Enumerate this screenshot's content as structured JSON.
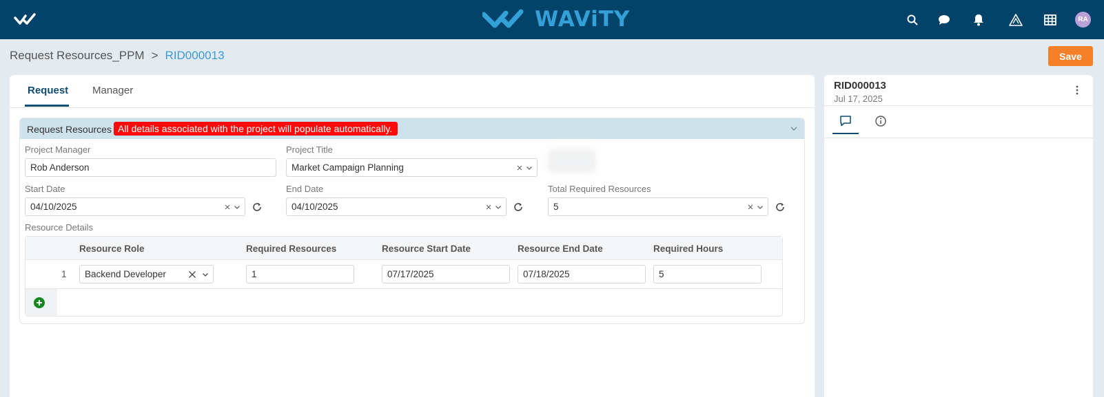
{
  "app": {
    "brand": "WAViTY",
    "avatar_initials": "RA"
  },
  "topbar": {
    "icons": [
      "menu-logo-icon",
      "search-icon",
      "chat-icon",
      "bell-icon",
      "warning-triangle-icon",
      "grid-icon"
    ]
  },
  "breadcrumb": {
    "parent": "Request Resources_PPM",
    "separator": ">",
    "current": "RID000013"
  },
  "save_label": "Save",
  "tabs": [
    {
      "label": "Request",
      "active": true
    },
    {
      "label": "Manager",
      "active": false
    }
  ],
  "section": {
    "title": "Request Resources",
    "note": "All details associated with the project will populate automatically."
  },
  "fields": {
    "project_manager": {
      "label": "Project Manager",
      "value": "Rob Anderson"
    },
    "project_title": {
      "label": "Project Title",
      "value": "Market Campaign Planning"
    },
    "start_date": {
      "label": "Start Date",
      "value": "04/10/2025"
    },
    "end_date": {
      "label": "End Date",
      "value": "04/10/2025"
    },
    "total_required_resources": {
      "label": "Total Required Resources",
      "value": "5"
    }
  },
  "resource_details": {
    "label": "Resource Details",
    "columns": [
      "Resource Role",
      "Required Resources",
      "Resource Start Date",
      "Resource End Date",
      "Required Hours"
    ],
    "rows": [
      {
        "num": "1",
        "role": "Backend Developer",
        "required_resources": "1",
        "start_date": "07/17/2025",
        "end_date": "07/18/2025",
        "required_hours": "5"
      }
    ]
  },
  "side_panel": {
    "id": "RID000013",
    "date": "Jul 17, 2025"
  },
  "colors": {
    "topbar": "#03436a",
    "brand": "#34a0d8",
    "save": "#f5802a",
    "note": "#ff0a0a",
    "section_header": "#cde2ea",
    "add": "#138a1f"
  }
}
